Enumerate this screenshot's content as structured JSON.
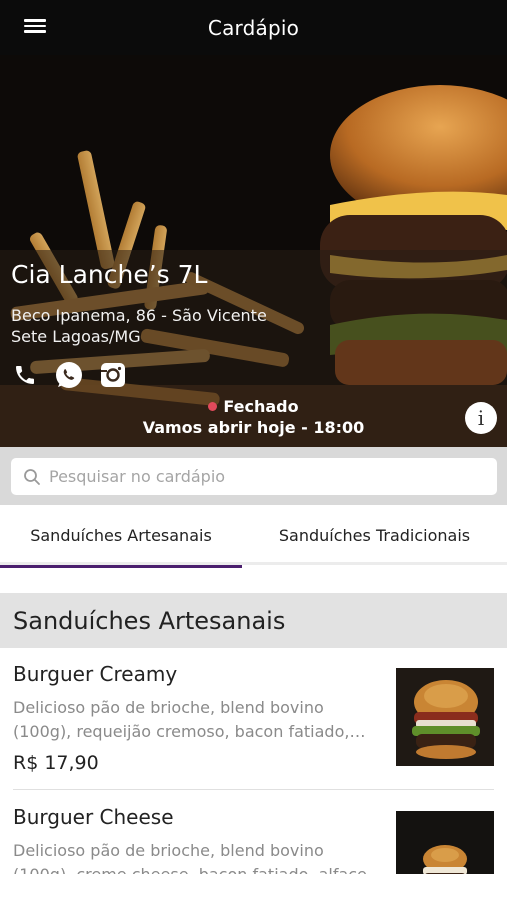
{
  "header": {
    "title": "Cardápio",
    "menu_icon": "hamburger-menu-icon"
  },
  "store": {
    "name": "Cia Lanche’s 7L",
    "address_line1": "Beco Ipanema, 86 - São Vicente",
    "address_line2": "Sete Lagoas/MG",
    "social_icons": [
      "phone-icon",
      "whatsapp-icon",
      "instagram-icon"
    ],
    "status": "Fechado",
    "status_color": "#e24a5b",
    "opening": "Vamos abrir hoje - 18:00",
    "info_label": "i"
  },
  "search": {
    "placeholder": "Pesquisar no cardápio"
  },
  "tabs": [
    {
      "label": "Sanduíches Artesanais",
      "active": true
    },
    {
      "label": "Sanduíches Tradicionais",
      "active": false
    }
  ],
  "accent_color": "#4b1f6e",
  "section": {
    "title": "Sanduíches Artesanais"
  },
  "products": [
    {
      "name": "Burguer Creamy",
      "description": "Delicioso pão de brioche, blend bovino (100g), requeijão cremoso, bacon fatiado, alface",
      "price": "R$ 17,90"
    },
    {
      "name": "Burguer Cheese",
      "description": "Delicioso pão de brioche, blend bovino (100g), creme cheese, bacon fatiado, alface",
      "price": ""
    }
  ]
}
